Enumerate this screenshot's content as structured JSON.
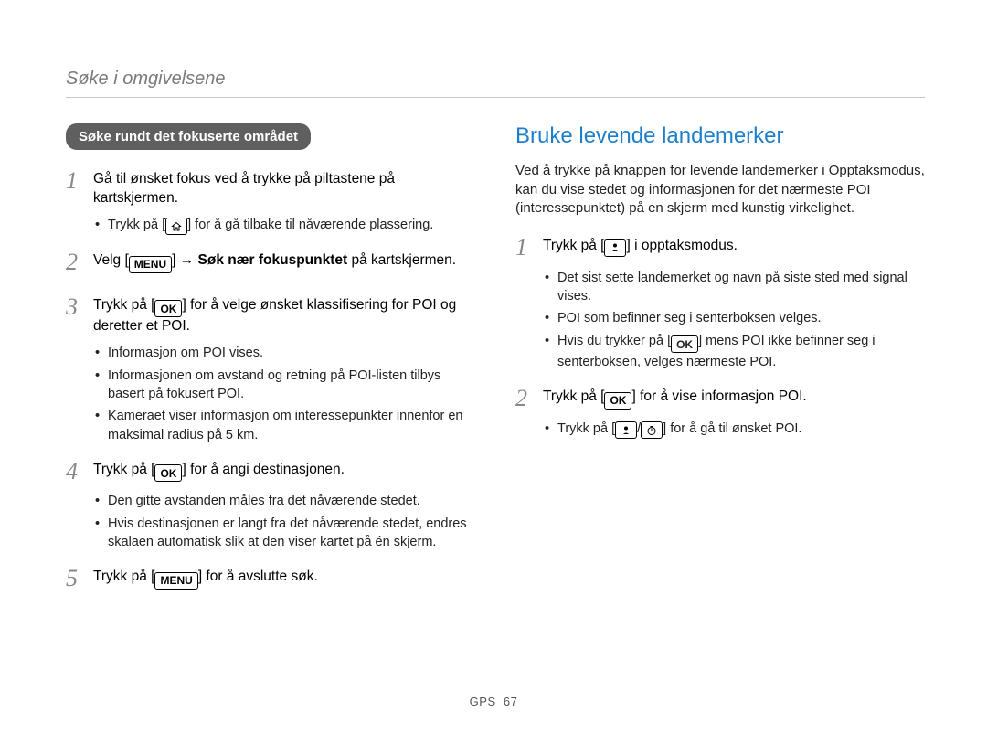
{
  "header": {
    "section_title": "Søke i omgivelsene"
  },
  "left": {
    "pill_label": "Søke rundt det fokuserte området",
    "steps": {
      "s1": {
        "num": "1",
        "text_a": "Gå til ønsket fokus ved å trykke på piltastene på kartskjermen."
      },
      "s1_bullets": {
        "b1_a": "Trykk på [",
        "b1_b": "] for å gå tilbake til nåværende plassering."
      },
      "s2": {
        "num": "2",
        "a": "Velg [",
        "menu": "MENU",
        "b": "] ",
        "arrow": "→",
        "c": " Søk nær fokuspunktet ",
        "d": "på kartskjermen."
      },
      "s3": {
        "num": "3",
        "a": "Trykk på [",
        "ok": "OK",
        "b": "] for å velge ønsket klassifisering for POI og deretter et POI."
      },
      "s3_bullets": {
        "b1": "Informasjon om POI vises.",
        "b2": "Informasjonen om avstand og retning på POI-listen tilbys basert på fokusert POI.",
        "b3": "Kameraet viser informasjon om interessepunkter innenfor en maksimal radius på 5 km."
      },
      "s4": {
        "num": "4",
        "a": "Trykk på [",
        "ok": "OK",
        "b": "] for å angi destinasjonen."
      },
      "s4_bullets": {
        "b1": "Den gitte avstanden måles fra det nåværende stedet.",
        "b2": "Hvis destinasjonen er langt fra det nåværende stedet, endres skalaen automatisk slik at den viser kartet på én skjerm."
      },
      "s5": {
        "num": "5",
        "a": "Trykk på [",
        "menu": "MENU",
        "b": "] for å avslutte søk."
      }
    }
  },
  "right": {
    "heading": "Bruke levende landemerker",
    "intro": "Ved å trykke på knappen for levende landemerker i Opptaksmodus, kan du vise stedet og informasjonen for det nærmeste POI (interessepunktet) på en skjerm med kunstig virkelighet.",
    "steps": {
      "s1": {
        "num": "1",
        "a": "Trykk på [",
        "b": "] i opptaksmodus."
      },
      "s1_bullets": {
        "b1": "Det sist sette landemerket og navn på siste sted med signal vises.",
        "b2": "POI som befinner seg i senterboksen velges.",
        "b3_a": "Hvis du trykker på [",
        "b3_ok": "OK",
        "b3_b": "] mens POI ikke befinner seg i senterboksen, velges nærmeste POI."
      },
      "s2": {
        "num": "2",
        "a": "Trykk på [",
        "ok": "OK",
        "b": "] for å vise informasjon POI."
      },
      "s2_bullets": {
        "b1_a": "Trykk på [",
        "b1_b": "/",
        "b1_c": "] for å gå til ønsket POI."
      }
    }
  },
  "footer": {
    "label": "GPS",
    "page": "67"
  }
}
